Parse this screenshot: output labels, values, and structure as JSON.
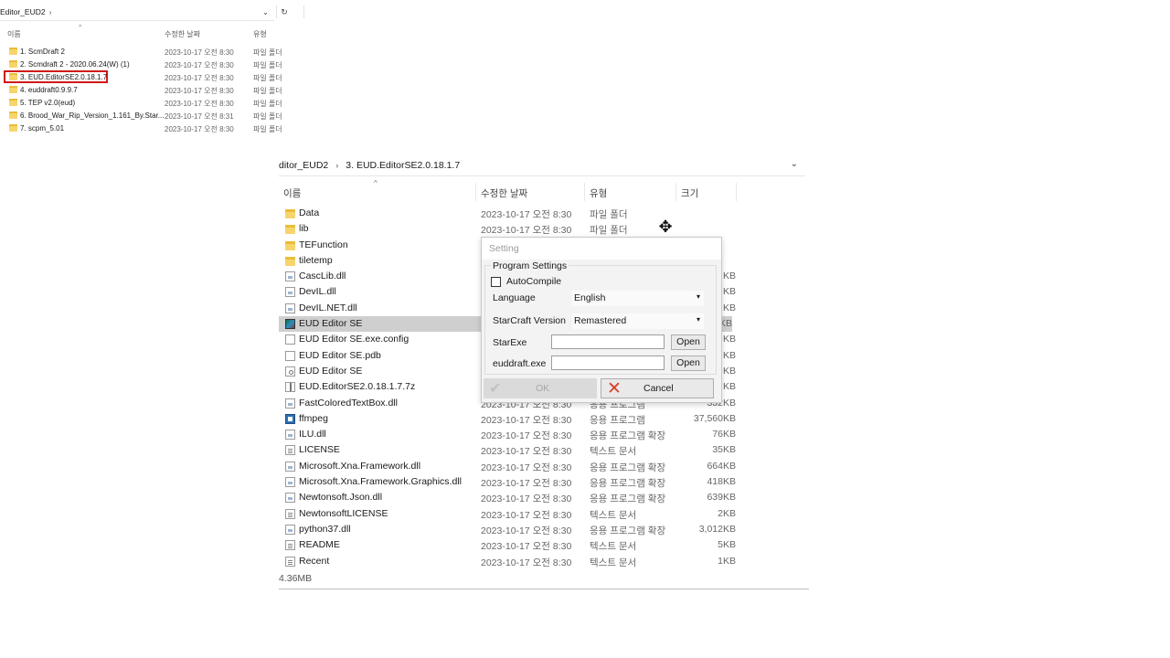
{
  "small_explorer": {
    "path": "Editor_EUD2",
    "col_name": "이름",
    "col_date": "수정한 날짜",
    "col_type": "유형",
    "rows": [
      {
        "name": "1. ScmDraft 2",
        "date": "2023-10-17 오전 8:30",
        "type": "파일 폴더"
      },
      {
        "name": "2. Scmdraft 2 - 2020.06.24(W) (1)",
        "date": "2023-10-17 오전 8:30",
        "type": "파일 폴더"
      },
      {
        "name": "3. EUD.EditorSE2.0.18.1.7",
        "date": "2023-10-17 오전 8:30",
        "type": "파일 폴더"
      },
      {
        "name": "4. euddraft0.9.9.7",
        "date": "2023-10-17 오전 8:30",
        "type": "파일 폴더"
      },
      {
        "name": "5. TEP v2.0(eud)",
        "date": "2023-10-17 오전 8:30",
        "type": "파일 폴더"
      },
      {
        "name": "6. Brood_War_Rip_Version_1.161_By.Star...",
        "date": "2023-10-17 오전 8:31",
        "type": "파일 폴더"
      },
      {
        "name": "7. scpm_5.01",
        "date": "2023-10-17 오전 8:30",
        "type": "파일 폴더"
      }
    ]
  },
  "main_explorer": {
    "crumb_parent": "ditor_EUD2",
    "crumb_current": "3. EUD.EditorSE2.0.18.1.7",
    "col_name": "이름",
    "col_date": "수정한 날짜",
    "col_type": "유형",
    "col_size": "크기",
    "rows": [
      {
        "icon": "folder",
        "name": "Data",
        "date": "2023-10-17 오전 8:30",
        "type": "파일 폴더",
        "size": ""
      },
      {
        "icon": "folder",
        "name": "lib",
        "date": "2023-10-17 오전 8:30",
        "type": "파일 폴더",
        "size": ""
      },
      {
        "icon": "folder",
        "name": "TEFunction",
        "date": "",
        "type": "",
        "size": ""
      },
      {
        "icon": "folder",
        "name": "tiletemp",
        "date": "",
        "type": "",
        "size": ""
      },
      {
        "icon": "dll",
        "name": "CascLib.dll",
        "date": "",
        "type": "",
        "size": "KB"
      },
      {
        "icon": "dll",
        "name": "DevIL.dll",
        "date": "",
        "type": "",
        "size": "KB"
      },
      {
        "icon": "dll",
        "name": "DevIL.NET.dll",
        "date": "",
        "type": "",
        "size": "KB"
      },
      {
        "icon": "game",
        "name": "EUD Editor SE",
        "date": "",
        "type": "",
        "size": "KB"
      },
      {
        "icon": "file",
        "name": "EUD Editor SE.exe.config",
        "date": "",
        "type": "",
        "size": "KB"
      },
      {
        "icon": "file",
        "name": "EUD Editor SE.pdb",
        "date": "",
        "type": "",
        "size": "KB"
      },
      {
        "icon": "config",
        "name": "EUD Editor SE",
        "date": "",
        "type": "",
        "size": "KB"
      },
      {
        "icon": "archive",
        "name": "EUD.EditorSE2.0.18.1.7.7z",
        "date": "",
        "type": "",
        "size": "KB"
      },
      {
        "icon": "dll",
        "name": "FastColoredTextBox.dll",
        "date": "2023-10-17 오전 8:30",
        "type": "응용 프로그램",
        "size": "332KB"
      },
      {
        "icon": "app",
        "name": "ffmpeg",
        "date": "2023-10-17 오전 8:30",
        "type": "응용 프로그램",
        "size": "37,560KB"
      },
      {
        "icon": "dll",
        "name": "ILU.dll",
        "date": "2023-10-17 오전 8:30",
        "type": "응용 프로그램 확장",
        "size": "76KB"
      },
      {
        "icon": "text",
        "name": "LICENSE",
        "date": "2023-10-17 오전 8:30",
        "type": "텍스트 문서",
        "size": "35KB"
      },
      {
        "icon": "dll",
        "name": "Microsoft.Xna.Framework.dll",
        "date": "2023-10-17 오전 8:30",
        "type": "응용 프로그램 확장",
        "size": "664KB"
      },
      {
        "icon": "dll",
        "name": "Microsoft.Xna.Framework.Graphics.dll",
        "date": "2023-10-17 오전 8:30",
        "type": "응용 프로그램 확장",
        "size": "418KB"
      },
      {
        "icon": "dll",
        "name": "Newtonsoft.Json.dll",
        "date": "2023-10-17 오전 8:30",
        "type": "응용 프로그램 확장",
        "size": "639KB"
      },
      {
        "icon": "text",
        "name": "NewtonsoftLICENSE",
        "date": "2023-10-17 오전 8:30",
        "type": "텍스트 문서",
        "size": "2KB"
      },
      {
        "icon": "dll",
        "name": "python37.dll",
        "date": "2023-10-17 오전 8:30",
        "type": "응용 프로그램 확장",
        "size": "3,012KB"
      },
      {
        "icon": "text",
        "name": "README",
        "date": "2023-10-17 오전 8:30",
        "type": "텍스트 문서",
        "size": "5KB"
      },
      {
        "icon": "text",
        "name": "Recent",
        "date": "2023-10-17 오전 8:30",
        "type": "텍스트 문서",
        "size": "1KB"
      }
    ],
    "status": "4.36MB"
  },
  "setting_dialog": {
    "title": "Setting",
    "group_label": "Program Settings",
    "autocompile_label": "AutoCompile",
    "language_label": "Language",
    "language_value": "English",
    "sc_version_label": "StarCraft Version",
    "sc_version_value": "Remastered",
    "starexe_label": "StarExe",
    "euddraft_label": "euddraft.exe",
    "open_label": "Open",
    "ok_label": "OK",
    "cancel_label": "Cancel"
  },
  "icons": {
    "folder": "folder-icon",
    "dll": "dll-file-icon",
    "app": "application-icon",
    "game": "eud-editor-app-icon",
    "text": "text-document-icon",
    "archive": "archive-7z-icon",
    "config": "config-file-icon",
    "cursor": "move-cursor-icon"
  }
}
